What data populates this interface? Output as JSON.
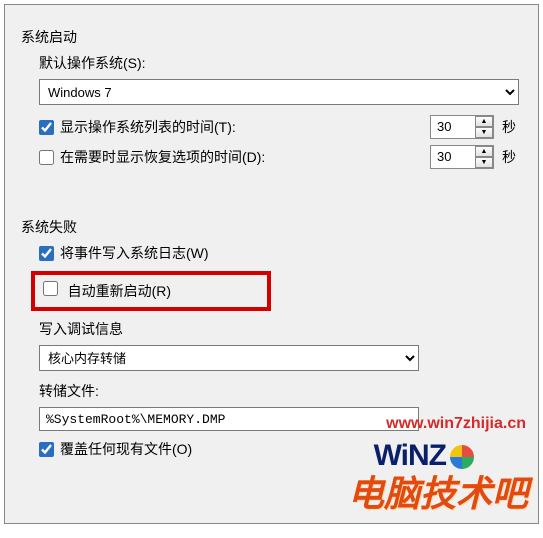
{
  "startup": {
    "group_title": "系统启动",
    "default_os_label": "默认操作系统(S):",
    "default_os_value": "Windows 7",
    "show_os_list": {
      "checked": true,
      "label": "显示操作系统列表的时间(T):",
      "seconds": "30",
      "unit": "秒"
    },
    "show_recovery": {
      "checked": false,
      "label": "在需要时显示恢复选项的时间(D):",
      "seconds": "30",
      "unit": "秒"
    }
  },
  "failure": {
    "group_title": "系统失败",
    "write_log": {
      "checked": true,
      "label": "将事件写入系统日志(W)"
    },
    "auto_restart": {
      "checked": false,
      "label": "自动重新启动(R)"
    },
    "debug_title": "写入调试信息",
    "dump_type": "核心内存转储",
    "dump_file_label": "转储文件:",
    "dump_file_value": "%SystemRoot%\\MEMORY.DMP",
    "overwrite": {
      "checked": true,
      "label": "覆盖任何现有文件(O)"
    }
  },
  "watermark": {
    "url": "www.win7zhijia.cn",
    "winz": "WiNZ",
    "logo": "电脑技术吧"
  }
}
